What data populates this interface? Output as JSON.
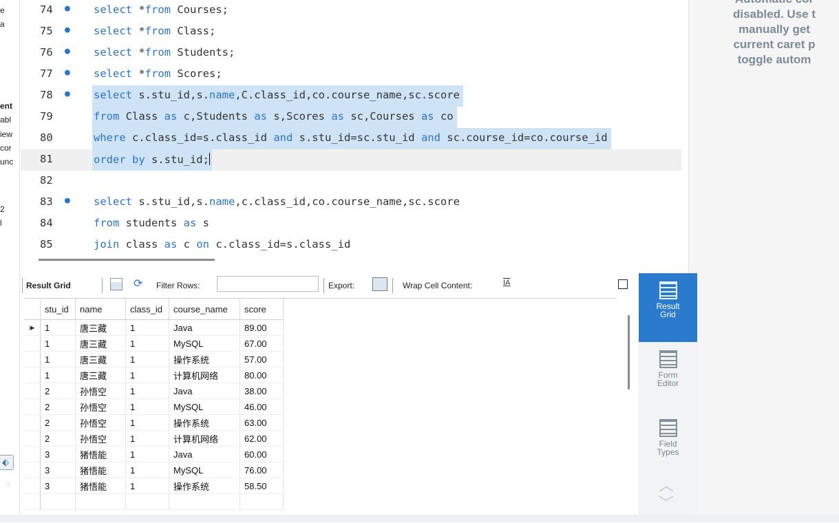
{
  "left_fragments": {
    "lines": [
      {
        "text": "e",
        "bold": false
      },
      {
        "text": "a",
        "bold": false
      },
      {
        "text": "ent",
        "bold": true
      },
      {
        "text": "abl",
        "bold": false
      },
      {
        "text": "iew",
        "bold": false
      },
      {
        "text": "cor",
        "bold": false
      },
      {
        "text": "unc",
        "bold": false
      },
      {
        "text": "2",
        "bold": false
      },
      {
        "text": "l",
        "bold": false
      }
    ],
    "nav_icon": "diamond-arrow-icon",
    "resize_grip_icon": "resize-grip-icon"
  },
  "editor": {
    "lines": [
      {
        "num": "74",
        "dot": true,
        "tokens": [
          [
            "k",
            "select"
          ],
          [
            "p",
            " *"
          ],
          [
            "k",
            "from"
          ],
          [
            "p",
            " Courses;"
          ]
        ]
      },
      {
        "num": "75",
        "dot": true,
        "tokens": [
          [
            "k",
            "select"
          ],
          [
            "p",
            " *"
          ],
          [
            "k",
            "from"
          ],
          [
            "p",
            " Class;"
          ]
        ]
      },
      {
        "num": "76",
        "dot": true,
        "tokens": [
          [
            "k",
            "select"
          ],
          [
            "p",
            " *"
          ],
          [
            "k",
            "from"
          ],
          [
            "p",
            " Students;"
          ]
        ]
      },
      {
        "num": "77",
        "dot": true,
        "tokens": [
          [
            "k",
            "select"
          ],
          [
            "p",
            " *"
          ],
          [
            "k",
            "from"
          ],
          [
            "p",
            " Scores;"
          ]
        ]
      },
      {
        "num": "78",
        "dot": true,
        "sel": true,
        "tokens": [
          [
            "k",
            "select"
          ],
          [
            "p",
            " s.stu_id,s."
          ],
          [
            "k",
            "name"
          ],
          [
            "p",
            ",C.class_id,co.course_name,sc.score"
          ]
        ]
      },
      {
        "num": "79",
        "dot": false,
        "sel": true,
        "tokens": [
          [
            "k",
            "from"
          ],
          [
            "p",
            " Class "
          ],
          [
            "k",
            "as"
          ],
          [
            "p",
            " c,Students "
          ],
          [
            "k",
            "as"
          ],
          [
            "p",
            " s,Scores "
          ],
          [
            "k",
            "as"
          ],
          [
            "p",
            " sc,Courses "
          ],
          [
            "k",
            "as"
          ],
          [
            "p",
            " co"
          ]
        ]
      },
      {
        "num": "80",
        "dot": false,
        "sel": true,
        "tokens": [
          [
            "k",
            "where"
          ],
          [
            "p",
            " c.class_id=s.class_id "
          ],
          [
            "k",
            "and"
          ],
          [
            "p",
            " s.stu_id=sc.stu_id "
          ],
          [
            "k",
            "and"
          ],
          [
            "p",
            " sc.course_id=co.course_id"
          ]
        ]
      },
      {
        "num": "81",
        "dot": false,
        "sel": true,
        "cur": true,
        "tokens": [
          [
            "k",
            "order by"
          ],
          [
            "p",
            " s.stu_id;"
          ]
        ]
      },
      {
        "num": "82",
        "dot": false,
        "tokens": []
      },
      {
        "num": "83",
        "dot": true,
        "tokens": [
          [
            "k",
            "select"
          ],
          [
            "p",
            " s.stu_id,s."
          ],
          [
            "k",
            "name"
          ],
          [
            "p",
            ",c.class_id,co.course_name,sc.score"
          ]
        ]
      },
      {
        "num": "84",
        "dot": false,
        "tokens": [
          [
            "k",
            "from"
          ],
          [
            "p",
            " students "
          ],
          [
            "k",
            "as"
          ],
          [
            "p",
            " s"
          ]
        ]
      },
      {
        "num": "85",
        "dot": false,
        "tokens": [
          [
            "k",
            "join"
          ],
          [
            "p",
            " class "
          ],
          [
            "k",
            "as"
          ],
          [
            "p",
            " c "
          ],
          [
            "k",
            "on"
          ],
          [
            "p",
            " c.class_id=s.class_id"
          ]
        ]
      }
    ],
    "keyword_color": "#2a74c9",
    "selection_color": "#cfe3f7"
  },
  "info_panel": {
    "lines": [
      "Automatic cor",
      "disabled. Use t",
      "manually get",
      "current caret p",
      "toggle autom"
    ],
    "color": "#7c8a99"
  },
  "result_toolbar": {
    "result_grid_label": "Result Grid",
    "filter_rows_label": "Filter Rows:",
    "filter_value": "",
    "export_label": "Export:",
    "wrap_label": "Wrap Cell Content:",
    "wrap_icon_text": "IA",
    "grid_icon": "grid-layout-icon",
    "refresh_icon": "refresh-icon",
    "export_icon": "export-icon",
    "toggle_panel_icon": "toggle-panel-icon"
  },
  "grid": {
    "columns": [
      "stu_id",
      "name",
      "class_id",
      "course_name",
      "score"
    ],
    "rows": [
      [
        "1",
        "唐三藏",
        "1",
        "Java",
        "89.00"
      ],
      [
        "1",
        "唐三藏",
        "1",
        "MySQL",
        "67.00"
      ],
      [
        "1",
        "唐三藏",
        "1",
        "操作系统",
        "57.00"
      ],
      [
        "1",
        "唐三藏",
        "1",
        "计算机网络",
        "80.00"
      ],
      [
        "2",
        "孙悟空",
        "1",
        "Java",
        "38.00"
      ],
      [
        "2",
        "孙悟空",
        "1",
        "MySQL",
        "46.00"
      ],
      [
        "2",
        "孙悟空",
        "1",
        "操作系统",
        "63.00"
      ],
      [
        "2",
        "孙悟空",
        "1",
        "计算机网络",
        "62.00"
      ],
      [
        "3",
        "猪悟能",
        "1",
        "Java",
        "60.00"
      ],
      [
        "3",
        "猪悟能",
        "1",
        "MySQL",
        "76.00"
      ],
      [
        "3",
        "猪悟能",
        "1",
        "操作系统",
        "58.50"
      ],
      [
        "",
        "",
        "",
        "",
        ""
      ]
    ],
    "current_row_marker": "▶"
  },
  "side_tabs": [
    {
      "label": "Result Grid",
      "icon": "result-grid-icon",
      "active": true
    },
    {
      "label": "Form Editor",
      "icon": "form-editor-icon",
      "active": false
    },
    {
      "label": "Field Types",
      "icon": "field-types-icon",
      "active": false
    }
  ],
  "colors": {
    "accent": "#2a7acd",
    "selection": "#cfe3f7"
  }
}
